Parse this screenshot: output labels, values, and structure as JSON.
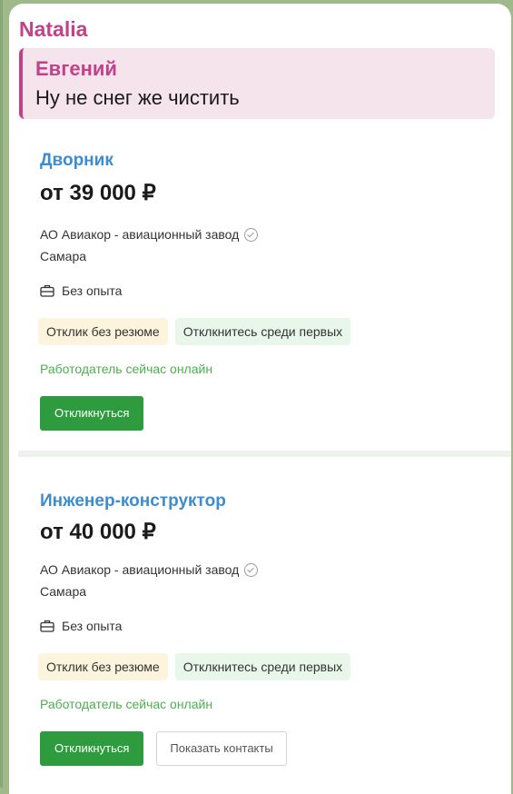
{
  "message": {
    "sender": "Natalia",
    "reply": {
      "author": "Евгений",
      "text": "Ну не снег же чистить"
    }
  },
  "vacancies": [
    {
      "title": "Дворник",
      "salary": "от 39 000 ₽",
      "company": "АО Авиакор - авиационный завод",
      "city": "Самара",
      "experience": "Без опыта",
      "tags": [
        "Отклик без резюме",
        "Отклкнитесь среди первых"
      ],
      "online_status": "Работодатель сейчас онлайн",
      "apply_label": "Откликнуться"
    },
    {
      "title": "Инженер-конструктор",
      "salary": "от 40 000 ₽",
      "company": "АО Авиакор - авиационный завод",
      "city": "Самара",
      "experience": "Без опыта",
      "tags": [
        "Отклик без резюме",
        "Отклкнитесь среди первых"
      ],
      "online_status": "Работодатель сейчас онлайн",
      "apply_label": "Откликнуться",
      "contacts_label": "Показать контакты"
    }
  ],
  "colors": {
    "sender": "#c2418a",
    "title_link": "#3c8cd0",
    "apply_button": "#2e9b3e",
    "online": "#4caf50"
  }
}
